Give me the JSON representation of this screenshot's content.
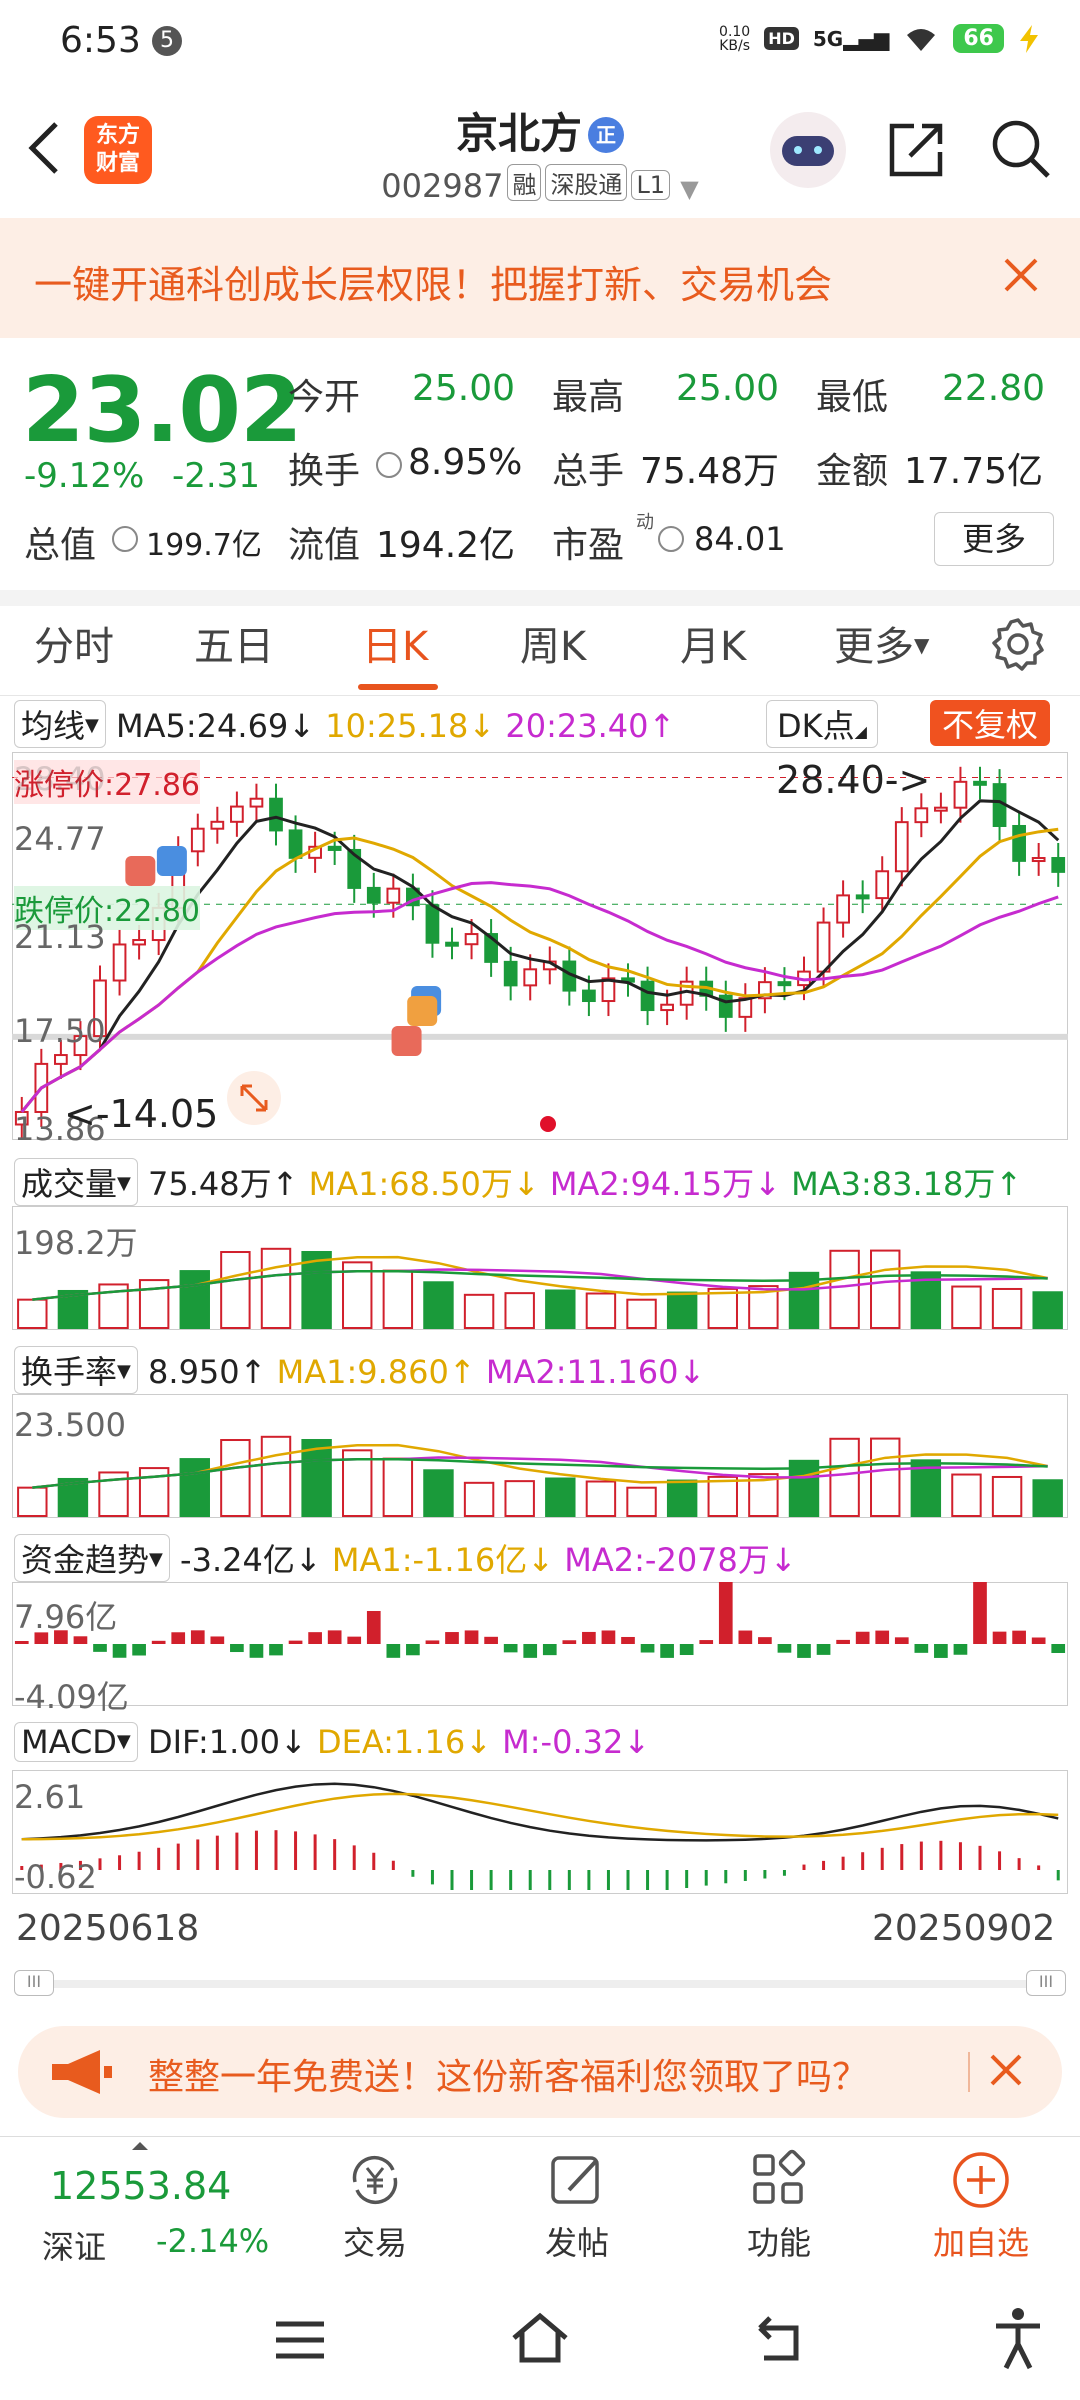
{
  "status_bar": {
    "time": "6:53",
    "notif": "5",
    "net_speed_top": "0.10",
    "net_speed_unit": "KB/s",
    "hd": "HD",
    "signal": "5G",
    "battery": "66"
  },
  "header": {
    "logo_line1": "东方",
    "logo_line2": "财富",
    "name": "京北方",
    "name_badge": "正",
    "code": "002987",
    "tags": [
      "融",
      "深股通",
      "L1"
    ]
  },
  "banner": {
    "text": "一键开通科创成长层权限！把握打新、交易机会"
  },
  "quote": {
    "price": "23.02",
    "change_pct": "-9.12%",
    "change": "-2.31",
    "open_label": "今开",
    "open": "25.00",
    "high_label": "最高",
    "high": "25.00",
    "low_label": "最低",
    "low": "22.80",
    "turnover_label": "换手",
    "turnover": "8.95%",
    "volume_label": "总手",
    "volume": "75.48万",
    "amount_label": "金额",
    "amount": "17.75亿",
    "mktcap_label": "总值",
    "mktcap": "199.7亿",
    "float_label": "流值",
    "float": "194.2亿",
    "pe_label": "市盈",
    "pe_sup": "动",
    "pe": "84.01",
    "more": "更多"
  },
  "tabs": [
    "分时",
    "五日",
    "日K",
    "周K",
    "月K",
    "更多"
  ],
  "active_tab": "日K",
  "kline": {
    "selector": "均线",
    "ma5": "MA5:24.69↓",
    "ma10": "10:25.18↓",
    "ma20": "20:23.40↑",
    "dk": "DK点",
    "fuquan": "不复权",
    "limit_up": "涨停价:27.86",
    "limit_down": "跌停价:22.80",
    "y_labels": [
      "28.40",
      "24.77",
      "21.13",
      "17.50",
      "13.86"
    ],
    "max_label": "28.40->",
    "min_label": "<-14.05",
    "markers": [
      "B",
      "S",
      "B",
      "S",
      "T"
    ]
  },
  "volume": {
    "selector": "成交量",
    "value": "75.48万↑",
    "ma1": "MA1:68.50万↓",
    "ma2": "MA2:94.15万↓",
    "ma3": "MA3:83.18万↑",
    "y_label": "198.2万"
  },
  "turnover_ind": {
    "selector": "换手率",
    "value": "8.950↑",
    "ma1": "MA1:9.860↑",
    "ma2": "MA2:11.160↓",
    "y_label": "23.500"
  },
  "fund": {
    "selector": "资金趋势",
    "value": "-3.24亿↓",
    "ma1": "MA1:-1.16亿↓",
    "ma2": "MA2:-2078万↓",
    "y_top": "7.96亿",
    "y_bottom": "-4.09亿"
  },
  "macd": {
    "selector": "MACD",
    "dif": "DIF:1.00↓",
    "dea": "DEA:1.16↓",
    "m": "M:-0.32↓",
    "y_top": "2.61",
    "y_bottom": "-0.62"
  },
  "dates": {
    "start": "20250618",
    "end": "20250902"
  },
  "scroll": {
    "handle": "III"
  },
  "ad": {
    "text": "整整一年免费送！这份新客福利您领取了吗？"
  },
  "bottom": {
    "index_value": "12553.84",
    "index_name": "深证",
    "index_pct": "-2.14%",
    "items": [
      "交易",
      "发帖",
      "功能",
      "加自选"
    ]
  },
  "colors": {
    "up": "#d1202c",
    "down": "#1a9a3a",
    "accent": "#e8541e"
  }
}
